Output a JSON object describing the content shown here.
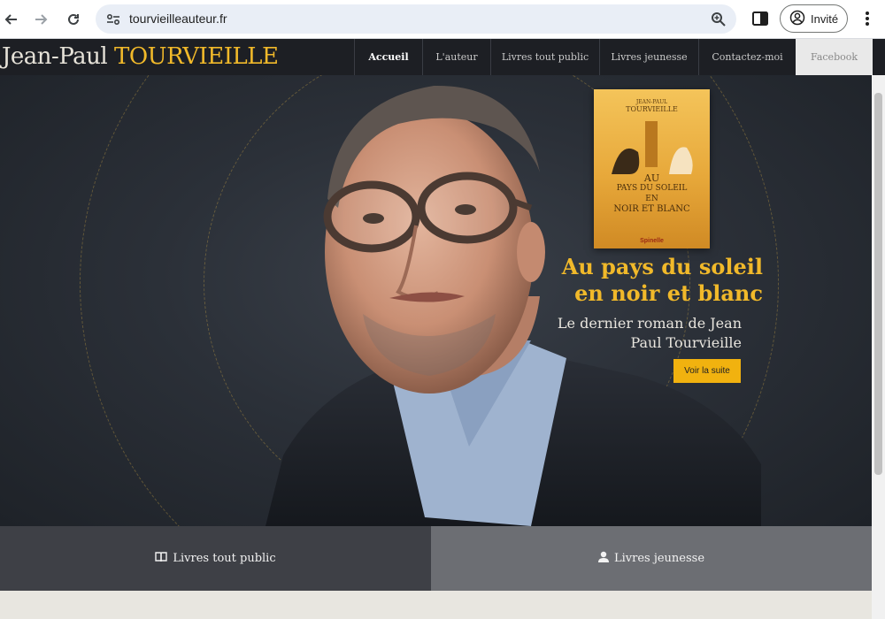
{
  "browser": {
    "url": "tourvieilleauteur.fr",
    "profile_label": "Invité",
    "icons": [
      "back-arrow-icon",
      "forward-arrow-icon",
      "reload-icon",
      "site-settings-icon",
      "zoom-icon",
      "side-panel-icon",
      "profile-icon",
      "menu-dots-icon"
    ]
  },
  "site": {
    "brand_first": "Jean-Paul",
    "brand_last": "TOURVIEILLE",
    "nav": [
      {
        "label": "Accueil",
        "active": true
      },
      {
        "label": "L'auteur"
      },
      {
        "label": "Livres tout public"
      },
      {
        "label": "Livres jeunesse"
      },
      {
        "label": "Contactez-moi"
      },
      {
        "label": "Facebook"
      }
    ]
  },
  "hero": {
    "book_cover": {
      "author_line1": "JEAN-PAUL",
      "author_line2": "TOURVIEILLE",
      "title_line1": "AU",
      "title_line2": "PAYS DU SOLEIL",
      "title_line3": "EN",
      "title_line4": "NOIR ET BLANC",
      "publisher": "Spinelle"
    },
    "title": "Au pays du soleil en noir et blanc",
    "subtitle": "Le dernier roman de Jean Paul Tourvieille",
    "cta_label": "Voir la suite"
  },
  "tiles": {
    "left_label": "Livres tout public",
    "left_icon": "book-icon",
    "right_label": "Livres jeunesse",
    "right_icon": "user-icon"
  },
  "colors": {
    "accent": "#f1b92a",
    "header_bg": "#1d1f24",
    "cta_bg": "#f1b20f"
  }
}
